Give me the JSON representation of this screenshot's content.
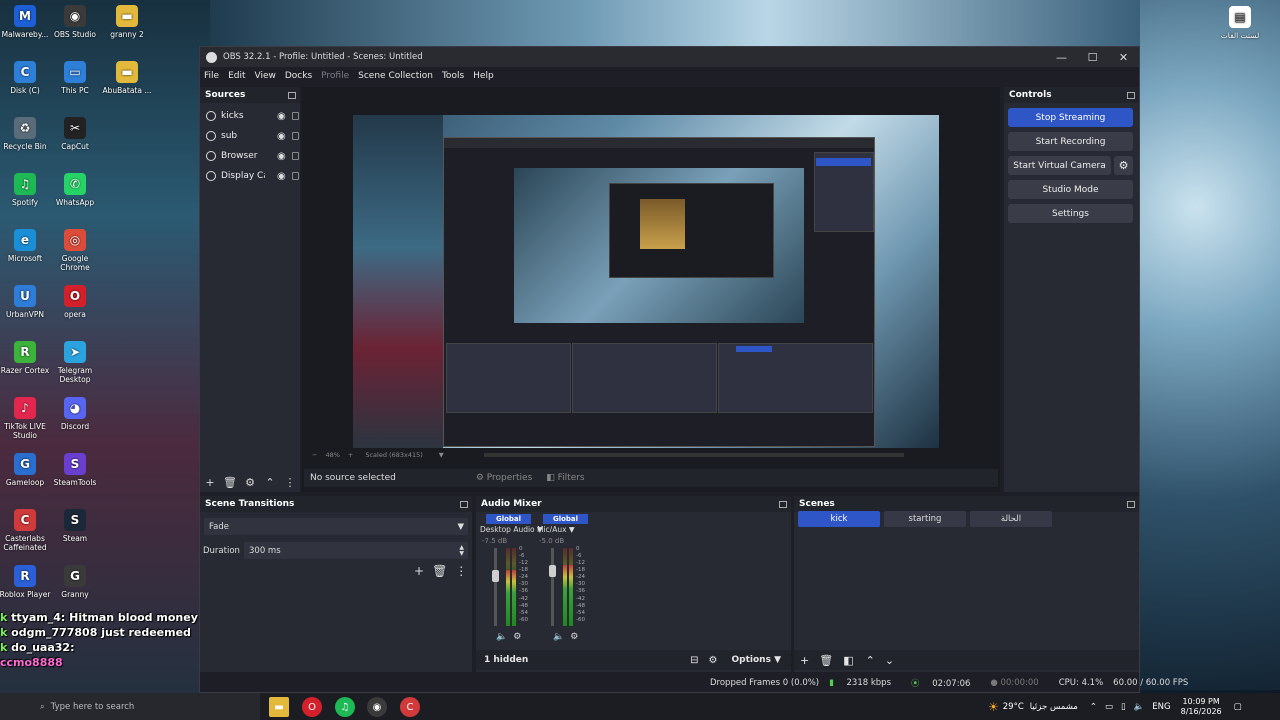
{
  "desktop": {
    "icons_left": [
      {
        "label": "Malwareby...",
        "glyph": "M",
        "color": "#1c5fd6"
      },
      {
        "label": "Disk (C)",
        "glyph": "C",
        "color": "#2d7fd8"
      },
      {
        "label": "Recycle Bin",
        "glyph": "♻",
        "color": "#5a6b7a"
      },
      {
        "label": "Spotify",
        "glyph": "♫",
        "color": "#1db954"
      },
      {
        "label": "Microsoft",
        "glyph": "e",
        "color": "#1a8fd8"
      },
      {
        "label": "UrbanVPN",
        "glyph": "U",
        "color": "#2e7dd8"
      },
      {
        "label": "Razer Cortex",
        "glyph": "R",
        "color": "#3cb43c"
      },
      {
        "label": "TikTok LIVE Studio",
        "glyph": "♪",
        "color": "#e2264d"
      },
      {
        "label": "Gameloop",
        "glyph": "G",
        "color": "#2a6fd0"
      },
      {
        "label": "Casterlabs Caffeinated",
        "glyph": "C",
        "color": "#d03a3a"
      },
      {
        "label": "Roblox Player",
        "glyph": "R",
        "color": "#2a5fd8"
      }
    ],
    "icons_left2": [
      {
        "label": "OBS Studio",
        "glyph": "◉",
        "color": "#3a3a3a"
      },
      {
        "label": "This PC",
        "glyph": "▭",
        "color": "#2d7fd8"
      },
      {
        "label": "CapCut",
        "glyph": "✂",
        "color": "#222222"
      },
      {
        "label": "WhatsApp",
        "glyph": "✆",
        "color": "#25d366"
      },
      {
        "label": "Google Chrome",
        "glyph": "◎",
        "color": "#dd4b39"
      },
      {
        "label": "opera",
        "glyph": "O",
        "color": "#d4202a"
      },
      {
        "label": "Telegram Desktop",
        "glyph": "➤",
        "color": "#2aa3df"
      },
      {
        "label": "Discord",
        "glyph": "◕",
        "color": "#5865f2"
      },
      {
        "label": "SteamTools",
        "glyph": "S",
        "color": "#6a3fd0"
      },
      {
        "label": "Steam",
        "glyph": "S",
        "color": "#1b2838"
      },
      {
        "label": "Granny",
        "glyph": "G",
        "color": "#3a3a3a"
      }
    ],
    "icons_top": [
      {
        "label": "granny 2",
        "glyph": "▬",
        "color": "#e3b93b"
      },
      {
        "label": "AbuBatata ...",
        "glyph": "▬",
        "color": "#e3b93b"
      }
    ],
    "icon_right": {
      "label": "لستت الفات",
      "glyph": "▤",
      "color": "#ffffff"
    }
  },
  "chat": [
    {
      "prefix": "k",
      "user": "ttyam_4:",
      "text": "Hitman blood money"
    },
    {
      "prefix": "k",
      "user": "odgm_777808",
      "text": "just redeemed"
    },
    {
      "prefix": "k",
      "user": "do_uaa32:",
      "text": ""
    },
    {
      "prefix": "",
      "user": "ccmo8888",
      "text": ""
    }
  ],
  "obs": {
    "title": "OBS 32.2.1 - Profile: Untitled - Scenes: Untitled",
    "window_controls": [
      "—",
      "☐",
      "✕"
    ],
    "menu": [
      {
        "label": "File",
        "dim": false
      },
      {
        "label": "Edit",
        "dim": false
      },
      {
        "label": "View",
        "dim": false
      },
      {
        "label": "Docks",
        "dim": false
      },
      {
        "label": "Profile",
        "dim": true
      },
      {
        "label": "Scene Collection",
        "dim": false
      },
      {
        "label": "Tools",
        "dim": false
      },
      {
        "label": "Help",
        "dim": false
      }
    ],
    "sources": {
      "title": "Sources",
      "items": [
        "kicks",
        "sub",
        "Browser",
        "Display Ca"
      ]
    },
    "source_toolbar": [
      "+",
      "🗑",
      "⚙",
      "⌃",
      "⋮"
    ],
    "selection": {
      "none_label": "No source selected",
      "properties": "Properties",
      "filters": "Filters"
    },
    "transform": {
      "zoom": "48%",
      "scaled": "Scaled (683x415)"
    },
    "controls": {
      "title": "Controls",
      "stop_streaming": "Stop Streaming",
      "start_recording": "Start Recording",
      "start_virtual_camera": "Start Virtual Camera",
      "studio_mode": "Studio Mode",
      "settings": "Settings"
    },
    "scene_transitions": {
      "title": "Scene Transitions",
      "transition": "Fade",
      "duration_label": "Duration",
      "duration_value": "300 ms"
    },
    "audio_mixer": {
      "title": "Audio Mixer",
      "channels": [
        {
          "tag": "Global",
          "name": "Desktop Audio",
          "db": "-7.5 dB",
          "level": 0.72
        },
        {
          "tag": "Global",
          "name": "Mic/Aux",
          "db": "-5.0 dB",
          "level": 0.78
        }
      ],
      "scale": [
        "0",
        "-6",
        "-12",
        "-18",
        "-24",
        "-30",
        "-36",
        "-42",
        "-48",
        "-54",
        "-60"
      ],
      "hidden": "1 hidden",
      "options": "Options"
    },
    "scenes": {
      "title": "Scenes",
      "items": [
        {
          "label": "kick",
          "active": true
        },
        {
          "label": "starting",
          "active": false
        },
        {
          "label": "الحالة",
          "active": false
        }
      ]
    },
    "status": {
      "dropped": "Dropped Frames 0 (0.0%)",
      "bitrate": "2318 kbps",
      "stream_time": "02:07:06",
      "rec_time": "00:00:00",
      "cpu": "CPU: 4.1%",
      "fps": "60.00 / 60.00 FPS"
    }
  },
  "taskbar": {
    "search": "Type here to search",
    "weather": "29°C",
    "weather_text": "مشمس جزئيا",
    "lang": "ENG",
    "time": "10:09 PM",
    "date": "8/16/2026"
  }
}
